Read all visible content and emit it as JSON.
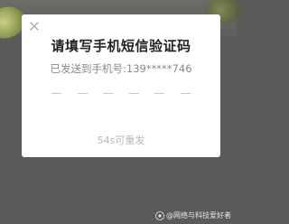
{
  "dialog": {
    "title": "请填写手机短信验证码",
    "subtitle": "已发送到手机号:139*****746",
    "code_slots": [
      "",
      "",
      "",
      "",
      "",
      ""
    ],
    "resend_label": "54s可重发"
  },
  "watermark": {
    "text": "@网络与科技爱好者"
  },
  "icons": {
    "close": "close-icon",
    "watermark_logo": "toutiao-logo-icon"
  },
  "colors": {
    "overlay": "#5a5a59",
    "dialog_bg": "#ffffff",
    "title": "#222222",
    "subtitle": "#8a8a8a",
    "slot_line": "#c8c8c8",
    "resend": "#b8b8b8"
  }
}
